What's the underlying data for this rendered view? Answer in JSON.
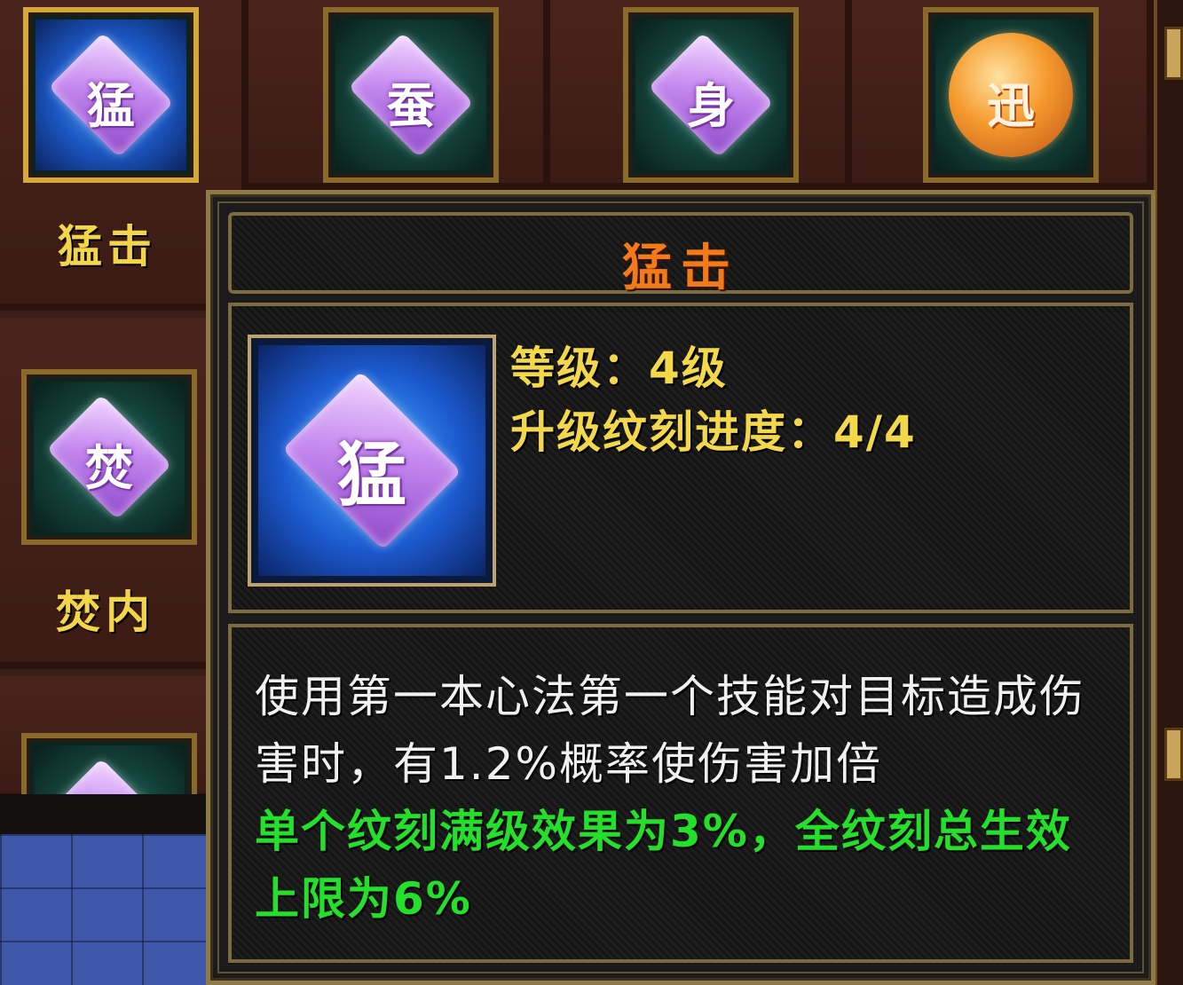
{
  "skills": [
    {
      "label": "猛击",
      "glyph": "猛",
      "type": "gem",
      "selected": true
    },
    {
      "label": "",
      "glyph": "蚕",
      "type": "gem",
      "selected": false
    },
    {
      "label": "",
      "glyph": "身",
      "type": "gem",
      "selected": false
    },
    {
      "label": "",
      "glyph": "迅",
      "type": "coin",
      "selected": false
    },
    {
      "label": "焚内",
      "glyph": "焚",
      "type": "gem",
      "selected": false
    },
    {
      "label": "",
      "glyph": "",
      "type": "gem",
      "selected": false
    }
  ],
  "tooltip": {
    "title": "猛击",
    "icon_glyph": "猛",
    "level_line": "等级：4级",
    "progress_line": "升级纹刻进度：4/4",
    "description": "使用第一本心法第一个技能对目标造成伤害时，有1.2%概率使伤害加倍",
    "bonus": "单个纹刻满级效果为3%，全纹刻总生效上限为6%"
  },
  "colors": {
    "title": "#f27a1a",
    "info": "#f4d84c",
    "description": "#f0f0f0",
    "bonus": "#25e02a",
    "label": "#f3d54a"
  }
}
